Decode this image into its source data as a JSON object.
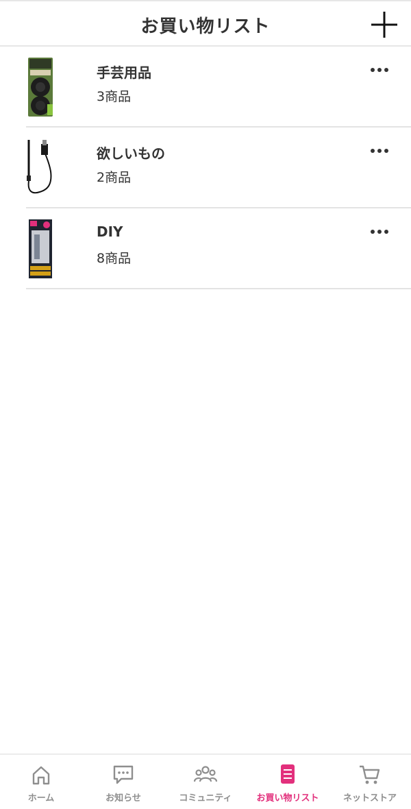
{
  "header": {
    "title": "お買い物リスト",
    "add_icon": "plus-icon"
  },
  "lists": [
    {
      "name": "手芸用品",
      "count": "3商品",
      "thumb_icon": "product-thumbnail"
    },
    {
      "name": "欲しいもの",
      "count": "2商品",
      "thumb_icon": "product-thumbnail"
    },
    {
      "name": "DIY",
      "count": "8商品",
      "thumb_icon": "product-thumbnail"
    }
  ],
  "tabbar": {
    "active_color": "#e2307c",
    "inactive_color": "#8e8e8e",
    "tabs": [
      {
        "label": "ホーム",
        "icon": "home-icon"
      },
      {
        "label": "お知らせ",
        "icon": "chat-bubble-icon"
      },
      {
        "label": "コミュニティ",
        "icon": "people-icon"
      },
      {
        "label": "お買い物リスト",
        "icon": "list-document-icon",
        "active": true
      },
      {
        "label": "ネットストア",
        "icon": "cart-icon"
      }
    ]
  }
}
